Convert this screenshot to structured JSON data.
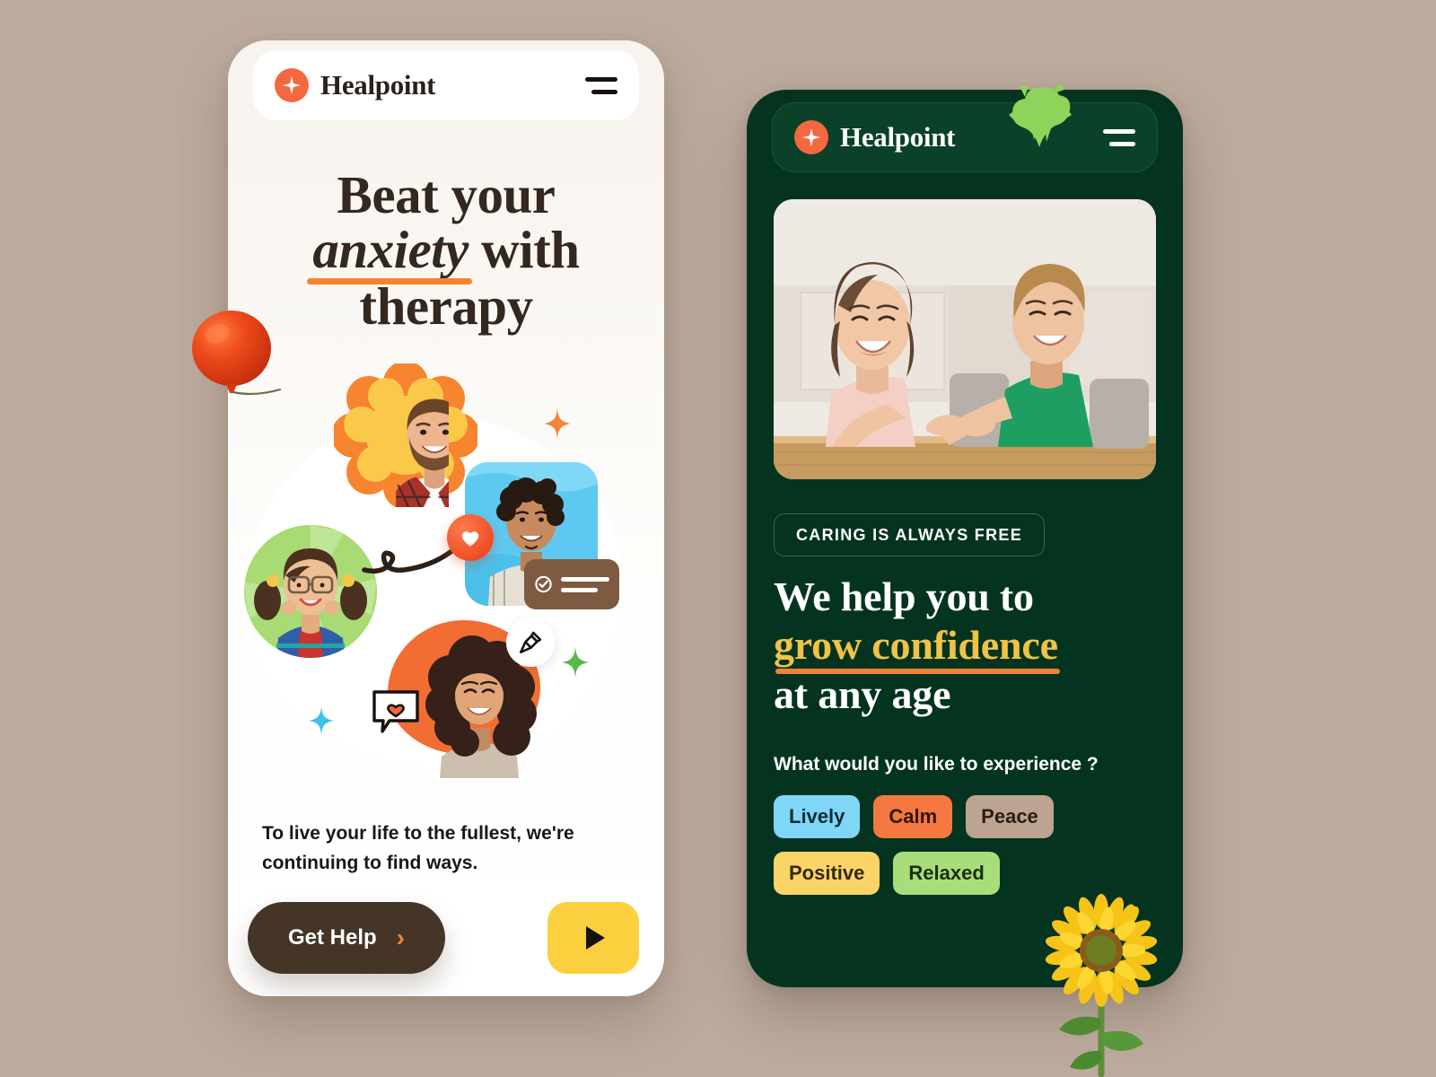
{
  "background_color": "#bcab9e",
  "phone_light": {
    "header": {
      "brand": "Healpoint",
      "logo_icon": "four-point-star-icon",
      "menu_icon": "hamburger-icon"
    },
    "headline": {
      "line1": "Beat your",
      "emphasis": "anxiety",
      "line2_rest": " with",
      "line3": "therapy"
    },
    "subcopy": "To live your life to the fullest, we're continuing to find ways.",
    "cta": {
      "primary_label": "Get Help",
      "primary_chevron": "›",
      "play_label": "play-icon"
    },
    "decorations": {
      "balloon": "red-balloon",
      "sparkle_orange": "sparkle-orange",
      "sparkle_green": "sparkle-green",
      "sparkle_blue": "sparkle-blue",
      "heart_badge": "heart-icon",
      "pin_badge": "pushpin-icon",
      "check_card": "verified-check-card",
      "speech_heart": "heart-speech-bubble"
    },
    "colors": {
      "brand_orange": "#f4683f",
      "underline_orange": "#f5832f",
      "button_brown": "#453527",
      "play_yellow": "#fbd03e",
      "card_brown": "#7e5a42",
      "blue_card": "#5ec9f0",
      "green_circle": "#a8db74",
      "orange_blob": "#f26d33",
      "surface": "#fdfbf8"
    }
  },
  "phone_dark": {
    "header": {
      "brand": "Healpoint",
      "logo_icon": "four-point-star-icon",
      "menu_icon": "hamburger-icon"
    },
    "photo_alt": "two-children-at-table-photo",
    "badge": "CARING IS ALWAYS FREE",
    "headline": {
      "line1": "We help you to",
      "emphasis": "grow confidence",
      "line3": "at any age"
    },
    "question": "What would you like to experience ?",
    "chips": [
      {
        "label": "Lively",
        "bg": "#7fd6f7",
        "fg": "#0f2a33"
      },
      {
        "label": "Calm",
        "bg": "#f4783f",
        "fg": "#33150b"
      },
      {
        "label": "Peace",
        "bg": "#bda392",
        "fg": "#2a1d15"
      },
      {
        "label": "Positive",
        "bg": "#fbd468",
        "fg": "#33280b"
      },
      {
        "label": "Relaxed",
        "bg": "#a9dd7c",
        "fg": "#17300d"
      }
    ],
    "decorations": {
      "leaf": "monstera-leaf",
      "sunflower": "sunflower",
      "green_dashes": "sparkle-dashes"
    },
    "colors": {
      "surface": "#04341f",
      "header": "#0a4128",
      "brand_orange": "#f4683f",
      "gold": "#f0c247",
      "underline_orange": "#ef8334",
      "leaf_green": "#8fd45a"
    }
  }
}
